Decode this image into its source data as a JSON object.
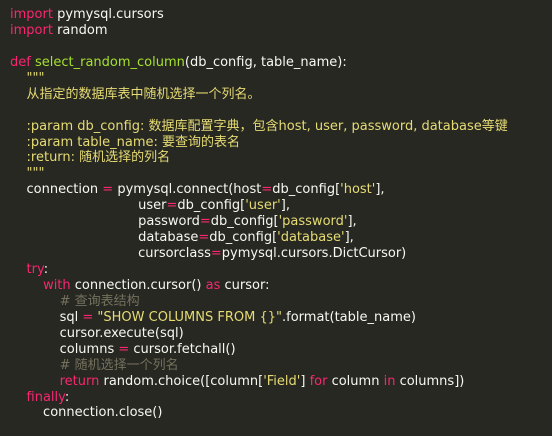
{
  "theme": {
    "background": "#272822",
    "foreground": "#f8f8f2",
    "keyword": "#f92672",
    "function": "#a6e22e",
    "string": "#e6db74",
    "comment": "#75715e",
    "builtin": "#66d9ef"
  },
  "lines": [
    [
      [
        "kw",
        "import"
      ],
      [
        "plain",
        " pymysql.cursors"
      ]
    ],
    [
      [
        "kw",
        "import"
      ],
      [
        "plain",
        " random"
      ]
    ],
    [],
    [
      [
        "kw",
        "def"
      ],
      [
        "plain",
        " "
      ],
      [
        "fn",
        "select_random_column"
      ],
      [
        "plain",
        "(db_config, table_name):"
      ]
    ],
    [
      [
        "str",
        "    \"\"\""
      ]
    ],
    [
      [
        "str",
        "    从指定的数据库表中随机选择一个列名。"
      ]
    ],
    [],
    [
      [
        "str",
        "    :param db_config: 数据库配置字典，包含host, user, password, database等键"
      ]
    ],
    [
      [
        "str",
        "    :param table_name: 要查询的表名"
      ]
    ],
    [
      [
        "str",
        "    :return: 随机选择的列名"
      ]
    ],
    [
      [
        "str",
        "    \"\"\""
      ]
    ],
    [
      [
        "plain",
        "    connection "
      ],
      [
        "kw",
        "="
      ],
      [
        "plain",
        " pymysql.connect(host"
      ],
      [
        "kw",
        "="
      ],
      [
        "plain",
        "db_config["
      ],
      [
        "str",
        "'host'"
      ],
      [
        "plain",
        "],"
      ]
    ],
    [
      [
        "plain",
        "                               user"
      ],
      [
        "kw",
        "="
      ],
      [
        "plain",
        "db_config["
      ],
      [
        "str",
        "'user'"
      ],
      [
        "plain",
        "],"
      ]
    ],
    [
      [
        "plain",
        "                               password"
      ],
      [
        "kw",
        "="
      ],
      [
        "plain",
        "db_config["
      ],
      [
        "str",
        "'password'"
      ],
      [
        "plain",
        "],"
      ]
    ],
    [
      [
        "plain",
        "                               database"
      ],
      [
        "kw",
        "="
      ],
      [
        "plain",
        "db_config["
      ],
      [
        "str",
        "'database'"
      ],
      [
        "plain",
        "],"
      ]
    ],
    [
      [
        "plain",
        "                               cursorclass"
      ],
      [
        "kw",
        "="
      ],
      [
        "plain",
        "pymysql.cursors.DictCursor)"
      ]
    ],
    [
      [
        "plain",
        "    "
      ],
      [
        "kw",
        "try"
      ],
      [
        "plain",
        ":"
      ]
    ],
    [
      [
        "plain",
        "        "
      ],
      [
        "kw",
        "with"
      ],
      [
        "plain",
        " connection.cursor() "
      ],
      [
        "kw",
        "as"
      ],
      [
        "plain",
        " cursor:"
      ]
    ],
    [
      [
        "cm",
        "            # 查询表结构"
      ]
    ],
    [
      [
        "plain",
        "            sql "
      ],
      [
        "kw",
        "="
      ],
      [
        "plain",
        " "
      ],
      [
        "str",
        "\"SHOW COLUMNS FROM {}\""
      ],
      [
        "plain",
        ".format(table_name)"
      ]
    ],
    [
      [
        "plain",
        "            cursor.execute(sql)"
      ]
    ],
    [
      [
        "plain",
        "            columns "
      ],
      [
        "kw",
        "="
      ],
      [
        "plain",
        " cursor.fetchall()"
      ]
    ],
    [
      [
        "cm",
        "            # 随机选择一个列名"
      ]
    ],
    [
      [
        "plain",
        "            "
      ],
      [
        "kw",
        "return"
      ],
      [
        "plain",
        " random.choice([column["
      ],
      [
        "str",
        "'Field'"
      ],
      [
        "plain",
        "] "
      ],
      [
        "kw",
        "for"
      ],
      [
        "plain",
        " column "
      ],
      [
        "kw",
        "in"
      ],
      [
        "plain",
        " columns])"
      ]
    ],
    [
      [
        "plain",
        "    "
      ],
      [
        "kw",
        "finally"
      ],
      [
        "plain",
        ":"
      ]
    ],
    [
      [
        "plain",
        "        connection.close()"
      ]
    ]
  ]
}
